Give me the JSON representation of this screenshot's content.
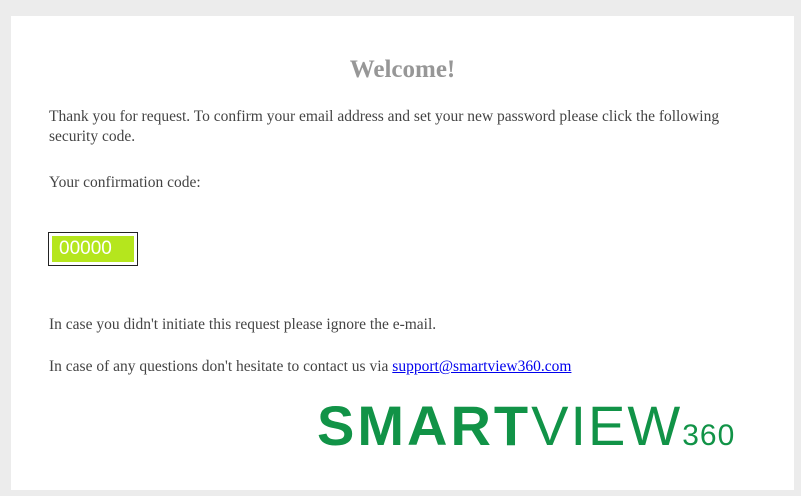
{
  "email": {
    "title": "Welcome!",
    "intro": "Thank you for request. To confirm your email address and set your new password please click the following security code.",
    "code_label": "Your confirmation code:",
    "code": "00000",
    "ignore_note": "In case you didn't initiate this request please ignore the e-mail.",
    "contact_prefix": "In case of any questions don't hesitate to contact us via ",
    "contact_email": "support@smartview360.com"
  },
  "logo": {
    "part1": "SMART",
    "part2": "VIEW",
    "part3": "360",
    "color": "#119347"
  },
  "colors": {
    "code_bg": "#b5e61d",
    "title": "#979797",
    "background": "#ececec"
  }
}
